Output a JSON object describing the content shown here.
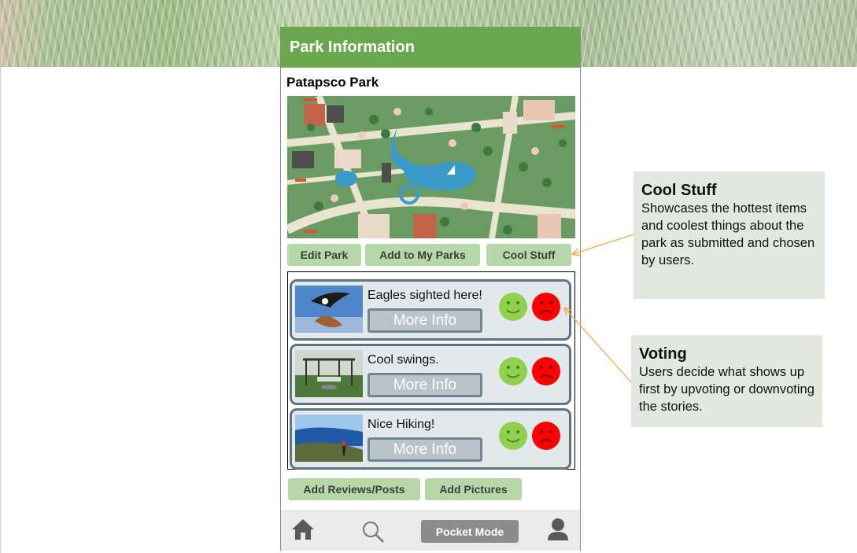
{
  "app": {
    "header_title": "Park Information",
    "park_name": "Patapsco Park"
  },
  "actions": {
    "edit_park": "Edit Park",
    "add_to_my_parks": "Add to My Parks",
    "cool_stuff": "Cool Stuff",
    "add_reviews": "Add Reviews/Posts",
    "add_pictures": "Add Pictures"
  },
  "stories": [
    {
      "title": "Eagles sighted here!",
      "more_label": "More Info",
      "thumb": "eagle-photo"
    },
    {
      "title": "Cool swings.",
      "more_label": "More Info",
      "thumb": "swings-photo"
    },
    {
      "title": "Nice Hiking!",
      "more_label": "More Info",
      "thumb": "hiking-photo"
    }
  ],
  "nav": {
    "home_icon": "home-icon",
    "search_icon": "search-icon",
    "pocket_mode": "Pocket Mode",
    "profile_icon": "user-icon"
  },
  "callouts": {
    "cool_stuff": {
      "title": "Cool Stuff",
      "body": "Showcases the hottest items and coolest things about the park as submitted and chosen by users."
    },
    "voting": {
      "title": "Voting",
      "body": "Users decide what shows up first by upvoting or downvoting the stories."
    }
  },
  "colors": {
    "header_green": "#6aa84f",
    "button_green": "#b6d7a8",
    "upvote": "#8fd14f",
    "downvote": "#ff0000",
    "callout_bg": "#e2e8e0",
    "arrow": "#f6a53b"
  }
}
